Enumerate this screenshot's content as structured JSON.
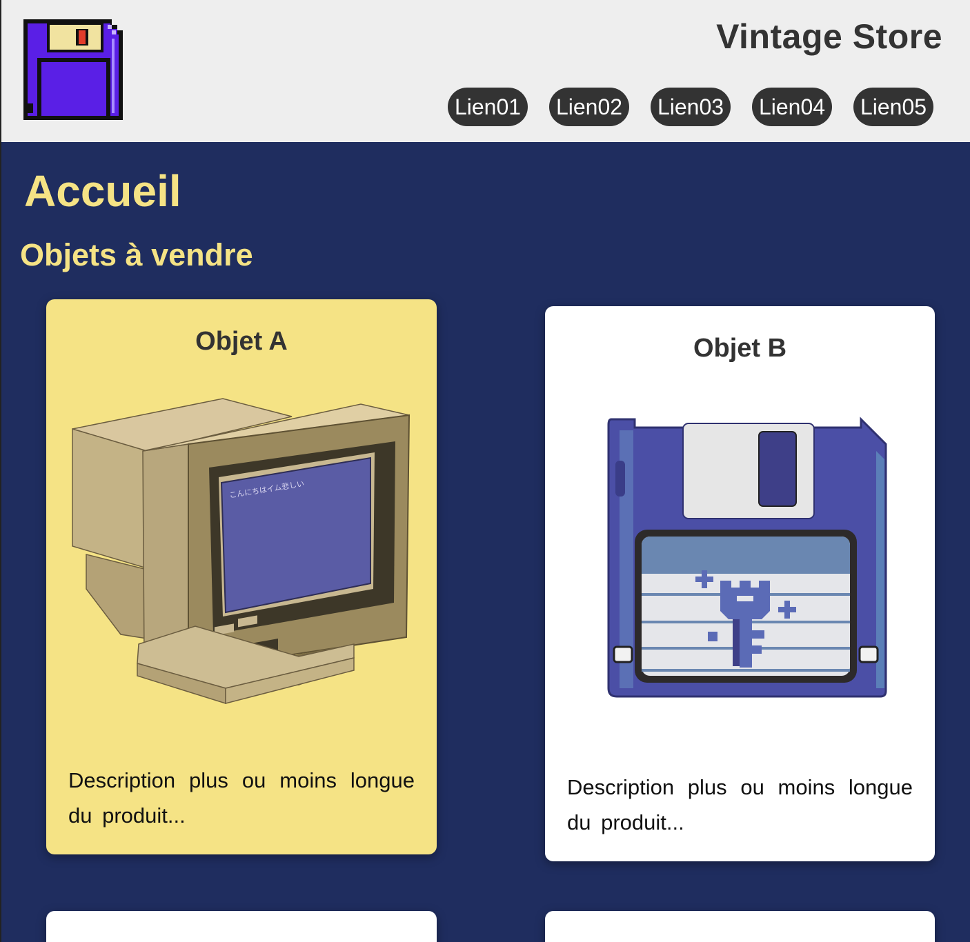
{
  "header": {
    "logo_icon": "floppy-disk-icon",
    "site_title": "Vintage Store",
    "nav": [
      "Lien01",
      "Lien02",
      "Lien03",
      "Lien04",
      "Lien05"
    ]
  },
  "main": {
    "page_title": "Accueil",
    "section_title": "Objets à vendre",
    "products": [
      {
        "title": "Objet A",
        "image": "retro-computer-monitor",
        "screen_text": "こんにちはイム悲しい",
        "description": "Description plus ou moins longue du produit..."
      },
      {
        "title": "Objet B",
        "image": "floppy-disk",
        "description": "Description plus ou moins longue du produit..."
      }
    ]
  },
  "colors": {
    "header_bg": "#eeeeee",
    "main_bg": "#1f2d5f",
    "heading_yellow": "#f5e385",
    "nav_pill": "#333333",
    "card_highlight": "#f5e385",
    "card_default": "#ffffff"
  }
}
